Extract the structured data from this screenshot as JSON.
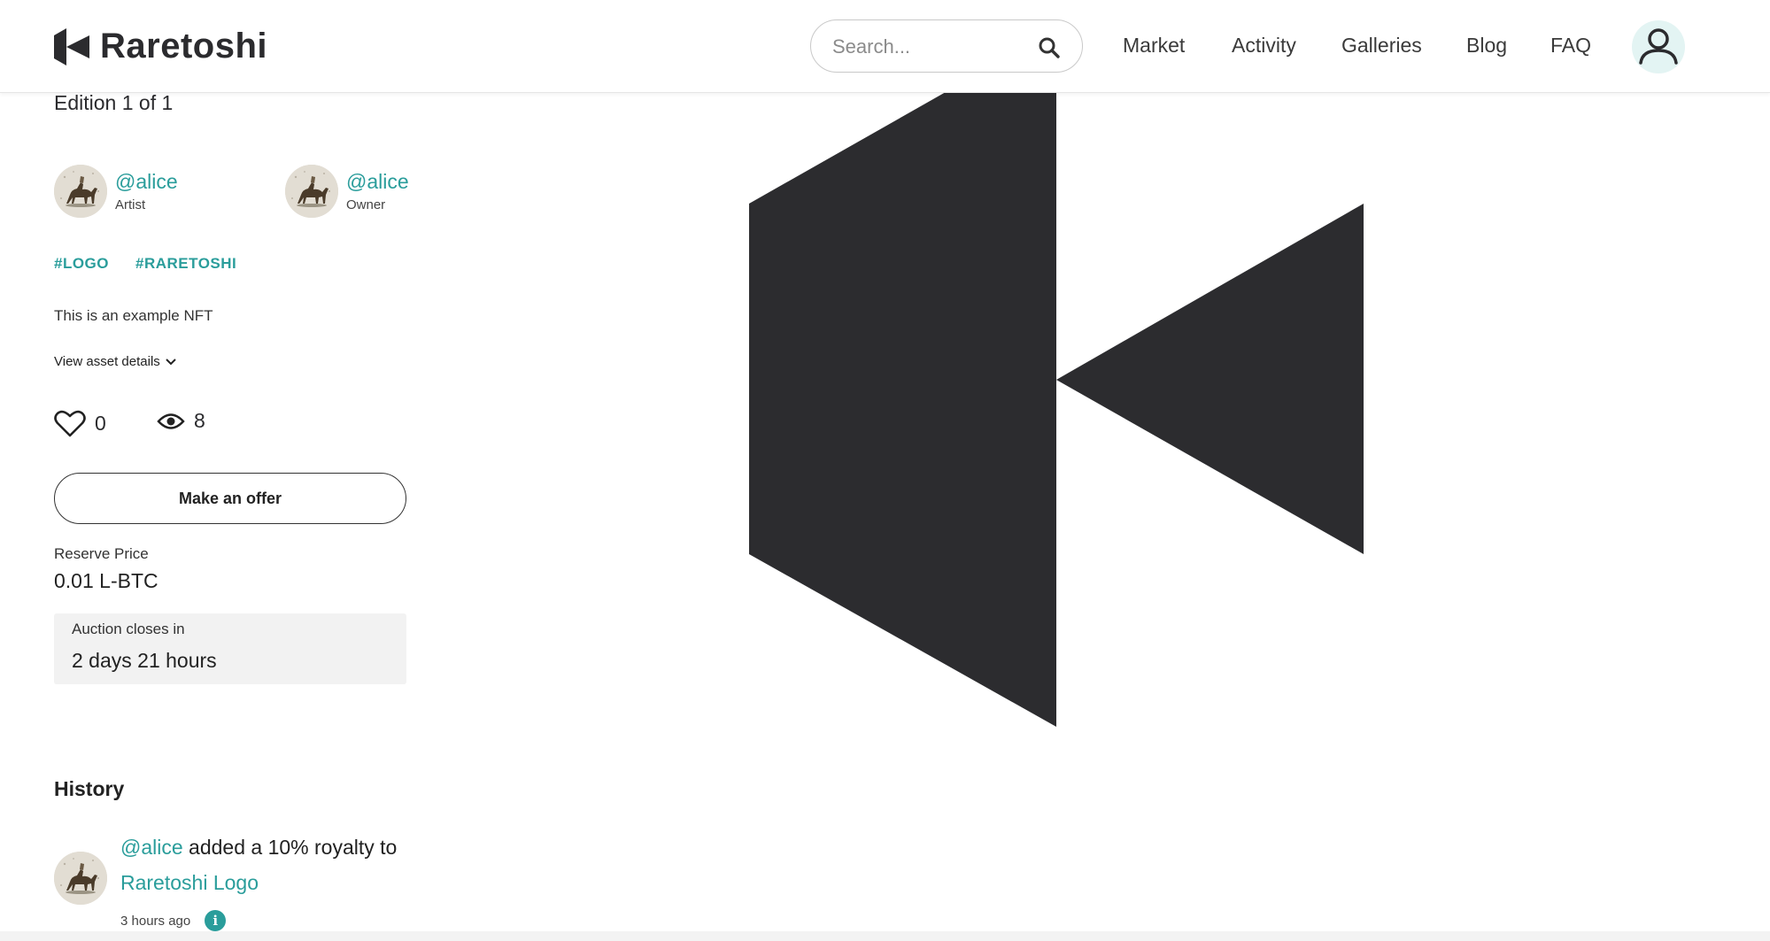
{
  "header": {
    "brand": "Raretoshi",
    "search": {
      "placeholder": "Search..."
    },
    "nav": [
      {
        "label": "Market"
      },
      {
        "label": "Activity"
      },
      {
        "label": "Galleries"
      },
      {
        "label": "Blog"
      },
      {
        "label": "FAQ"
      }
    ],
    "accent_color": "#2a9d9b"
  },
  "asset": {
    "edition": "Edition 1 of 1",
    "artist": {
      "handle": "@alice",
      "role": "Artist"
    },
    "owner": {
      "handle": "@alice",
      "role": "Owner"
    },
    "tags": [
      "#LOGO",
      "#RARETOSHI"
    ],
    "description": "This is an example NFT",
    "details_link": "View asset details",
    "likes": "0",
    "views": "8",
    "offer_button": "Make an offer",
    "reserve_label": "Reserve Price",
    "reserve_value": "0.01 L-BTC",
    "auction_label": "Auction closes in",
    "auction_value": "2 days 21 hours"
  },
  "history": {
    "title": "History",
    "items": [
      {
        "user": "@alice",
        "text": " added a 10% royalty to",
        "target": "Raretoshi Logo",
        "time": "3 hours ago"
      }
    ]
  },
  "icons": {
    "search": "search-icon",
    "user": "user-icon",
    "heart": "heart-icon",
    "eye": "eye-icon",
    "chevron": "chevron-down-icon",
    "info": "info-icon"
  }
}
